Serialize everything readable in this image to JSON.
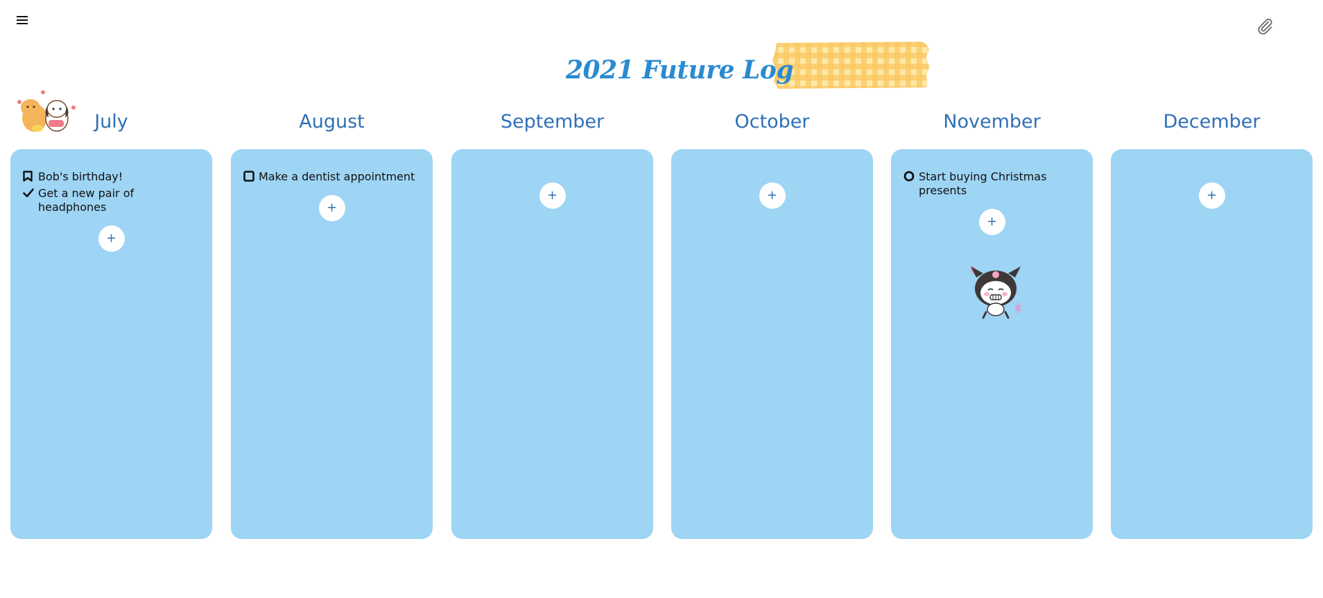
{
  "app": {
    "menu_icon": "hamburger-menu-icon",
    "attach_icon": "paperclip-icon"
  },
  "header": {
    "title": "2021 Future Log",
    "washi_colors": [
      "#fde9a6",
      "#fbc661",
      "#f8b342"
    ]
  },
  "colors": {
    "card_bg": "#9ed4f4",
    "month_text": "#2f6fb5",
    "title_text": "#2a8ad0"
  },
  "months": [
    {
      "name": "July",
      "tasks": [
        {
          "icon": "bookmark-icon",
          "text": "Bob's birthday!"
        },
        {
          "icon": "checkmark-icon",
          "text": "Get a new pair of headphones"
        }
      ],
      "add_label": "+"
    },
    {
      "name": "August",
      "tasks": [
        {
          "icon": "checkbox-icon",
          "text": "Make a dentist appointment"
        }
      ],
      "add_label": "+"
    },
    {
      "name": "September",
      "tasks": [],
      "add_label": "+"
    },
    {
      "name": "October",
      "tasks": [],
      "add_label": "+"
    },
    {
      "name": "November",
      "tasks": [
        {
          "icon": "circle-icon",
          "text": "Start buying Christmas presents"
        }
      ],
      "add_label": "+"
    },
    {
      "name": "December",
      "tasks": [],
      "add_label": "+"
    }
  ],
  "stickers": [
    "bear-and-puppy-sticker",
    "kuromi-sticker"
  ]
}
